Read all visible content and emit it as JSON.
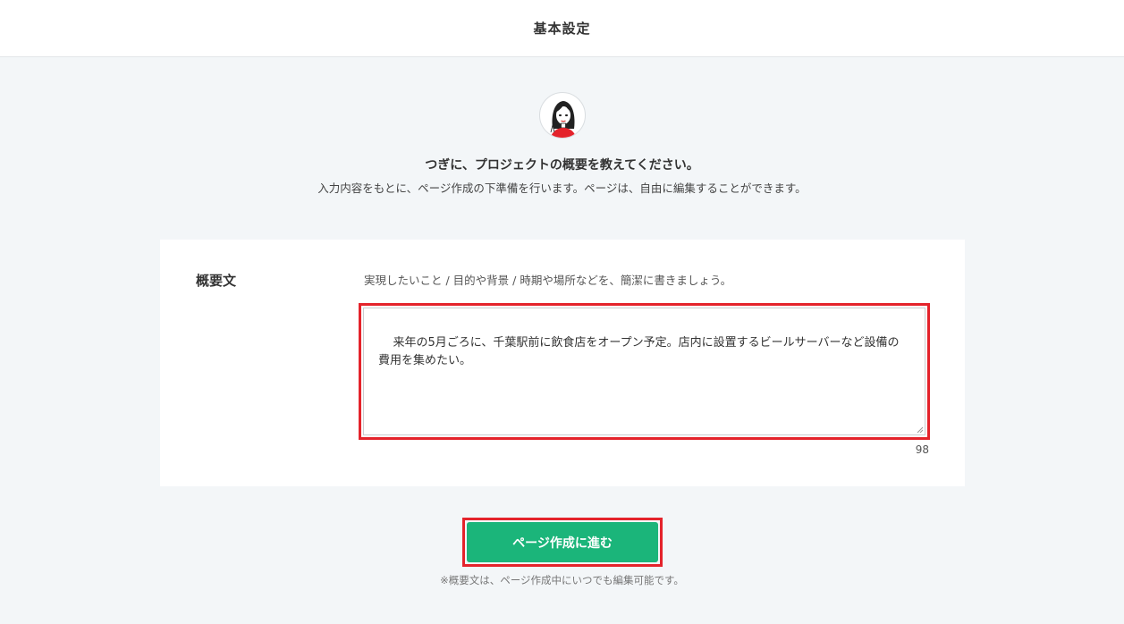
{
  "header": {
    "title": "基本設定"
  },
  "intro": {
    "avatar_icon": "woman-avatar-icon",
    "heading": "つぎに、プロジェクトの概要を教えてください。",
    "subheading": "入力内容をもとに、ページ作成の下準備を行います。ページは、自由に編集することができます。"
  },
  "form": {
    "label": "概要文",
    "hint": "実現したいこと / 目的や背景 / 時期や場所などを、簡潔に書きましょう。",
    "value": "来年の5月ごろに、千葉駅前に飲食店をオープン予定。店内に設置するビールサーバーなど設備の費用を集めたい。",
    "char_count": "98"
  },
  "actions": {
    "submit_label": "ページ作成に進む",
    "note": "※概要文は、ページ作成中にいつでも編集可能です。"
  },
  "colors": {
    "accent": "#1bb57a",
    "highlight": "#e4232b",
    "background": "#f3f6f8"
  }
}
